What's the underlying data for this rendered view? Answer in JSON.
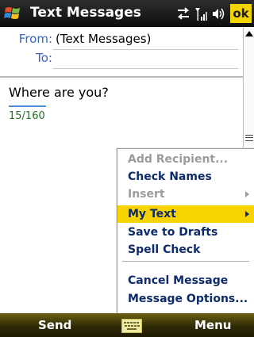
{
  "titlebar": {
    "app_icon": "windows-flag-icon",
    "title": "Text Messages",
    "status_icons": [
      "sync-arrows-icon",
      "signal-strength-icon",
      "speaker-icon"
    ],
    "ok_label": "ok"
  },
  "header": {
    "from_label": "From:",
    "from_value": "(Text Messages)",
    "to_label": "To:",
    "to_value": ""
  },
  "message": {
    "body": "Where are you?",
    "counter": "15/160"
  },
  "menu": {
    "items": [
      {
        "label": "Add Recipient...",
        "enabled": false
      },
      {
        "label": "Check Names",
        "enabled": true
      },
      {
        "label": "Insert",
        "enabled": false,
        "submenu": true
      },
      {
        "label": "My Text",
        "enabled": true,
        "submenu": true,
        "selected": true
      },
      {
        "label": "Save to Drafts",
        "enabled": true
      },
      {
        "label": "Spell Check",
        "enabled": true
      },
      {
        "label": "Cancel Message",
        "enabled": true
      },
      {
        "label": "Message Options...",
        "enabled": true
      }
    ],
    "highlight_color": "#f7d400"
  },
  "softkeys": {
    "left": "Send",
    "center_icon": "keyboard-icon",
    "right": "Menu"
  }
}
